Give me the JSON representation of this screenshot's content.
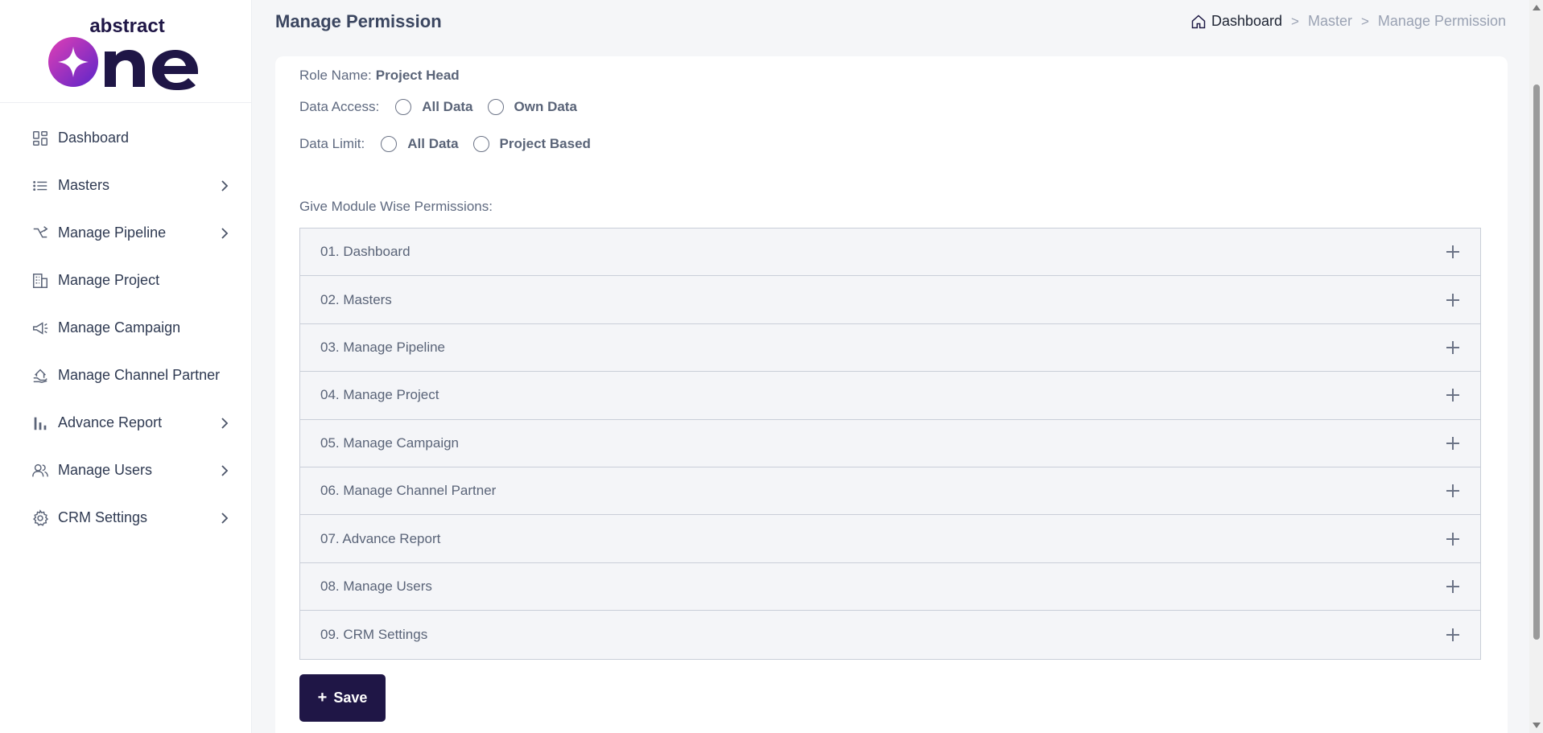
{
  "app": {
    "logo_text_top": "abstract",
    "logo_text_main": "one",
    "brand_color": "#1f1646",
    "accent_gradient": [
      "#e03fb5",
      "#6a2bd8"
    ]
  },
  "sidebar": {
    "items": [
      {
        "label": "Dashboard",
        "icon": "dashboard-icon",
        "has_chevron": false
      },
      {
        "label": "Masters",
        "icon": "list-icon",
        "has_chevron": true
      },
      {
        "label": "Manage Pipeline",
        "icon": "pipeline-icon",
        "has_chevron": true
      },
      {
        "label": "Manage Project",
        "icon": "building-icon",
        "has_chevron": false
      },
      {
        "label": "Manage Campaign",
        "icon": "megaphone-icon",
        "has_chevron": false
      },
      {
        "label": "Manage Channel Partner",
        "icon": "handshake-house-icon",
        "has_chevron": false
      },
      {
        "label": "Advance Report",
        "icon": "bar-chart-icon",
        "has_chevron": true
      },
      {
        "label": "Manage Users",
        "icon": "users-icon",
        "has_chevron": true
      },
      {
        "label": "CRM Settings",
        "icon": "gear-icon",
        "has_chevron": true
      }
    ]
  },
  "header": {
    "title": "Manage Permission",
    "breadcrumb": {
      "home": "Dashboard",
      "sep": ">",
      "items": [
        "Master",
        "Manage Permission"
      ]
    }
  },
  "form": {
    "role_name_label": "Role Name:",
    "role_name_value": "Project Head",
    "data_access": {
      "label": "Data Access:",
      "options": [
        "All Data",
        "Own Data"
      ]
    },
    "data_limit": {
      "label": "Data Limit:",
      "options": [
        "All Data",
        "Project Based"
      ]
    },
    "modules_label": "Give Module Wise Permissions:",
    "modules": [
      "01. Dashboard",
      "02. Masters",
      "03. Manage Pipeline",
      "04. Manage Project",
      "05. Manage Campaign",
      "06. Manage Channel Partner",
      "07. Advance Report",
      "08. Manage Users",
      "09. CRM Settings"
    ],
    "save_plus": "+",
    "save_label": "Save"
  }
}
